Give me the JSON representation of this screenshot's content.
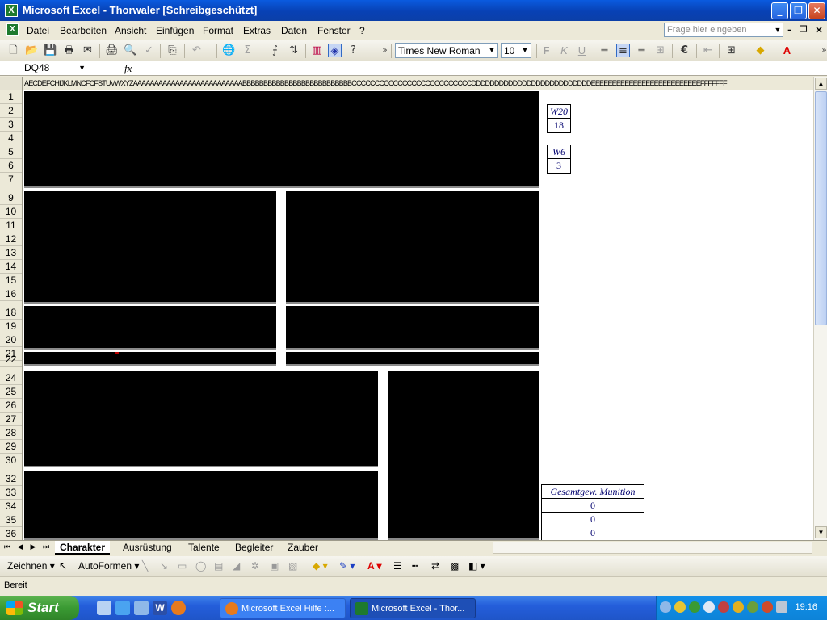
{
  "window": {
    "title": "Microsoft Excel - Thorwaler  [Schreibgeschützt]",
    "app_icon": "excel-icon",
    "controls": [
      "minimize",
      "restore",
      "close"
    ]
  },
  "menubar": {
    "items": [
      "Datei",
      "Bearbeiten",
      "Ansicht",
      "Einfügen",
      "Format",
      "Extras",
      "Daten",
      "Fenster",
      "?"
    ],
    "ask_placeholder": "Frage hier eingeben"
  },
  "toolbar": {
    "font_name": "Times New Roman",
    "font_size": "10",
    "bold_label": "F",
    "italic_label": "K",
    "underline_label": "U",
    "euro_label": "€"
  },
  "formula_bar": {
    "name_box": "DQ48",
    "fx_label": "fx",
    "content": ""
  },
  "sheet": {
    "column_header_text": "AECDEFCHIJKLMNCFCFSTUVWXYZAAAAAAAAAAAAAAAAAAAAAAAAAABBBBBBBBBBBBBBBBBBBBBBBBBBCCCCCCCCCCCCCCCCCCCCCCCCCCDDDDDDDDDDDDDDDDDDDDDDDDDDEEEEEEEEEEEEEEEEEEEEEEEEEEFFFFFFF",
    "rows": [
      "1",
      "2",
      "3",
      "4",
      "5",
      "6",
      "7",
      "9",
      "10",
      "11",
      "12",
      "13",
      "14",
      "15",
      "16",
      "18",
      "19",
      "20",
      "21",
      "22",
      "24",
      "25",
      "26",
      "27",
      "28",
      "29",
      "30",
      "32",
      "33",
      "34",
      "35",
      "36"
    ],
    "dice": [
      {
        "label": "W20",
        "value": "18"
      },
      {
        "label": "W6",
        "value": "3"
      }
    ],
    "munition": {
      "header": "Gesamtgew. Munition",
      "values": [
        "0",
        "0",
        "0"
      ]
    }
  },
  "tabs": {
    "items": [
      "Charakter",
      "Ausrüstung",
      "Talente",
      "Begleiter",
      "Zauber"
    ],
    "active": "Charakter"
  },
  "drawing_toolbar": {
    "draw_label": "Zeichnen",
    "autoshapes_label": "AutoFormen"
  },
  "status": {
    "text": "Bereit"
  },
  "taskbar": {
    "start_label": "Start",
    "tasks": [
      "Microsoft Excel Hilfe :...",
      "Microsoft Excel - Thor..."
    ],
    "clock": "19:16"
  },
  "colors": {
    "title_blue": "#0841b4",
    "cell_text_blue": "#00006e",
    "start_green": "#3a9a33"
  }
}
